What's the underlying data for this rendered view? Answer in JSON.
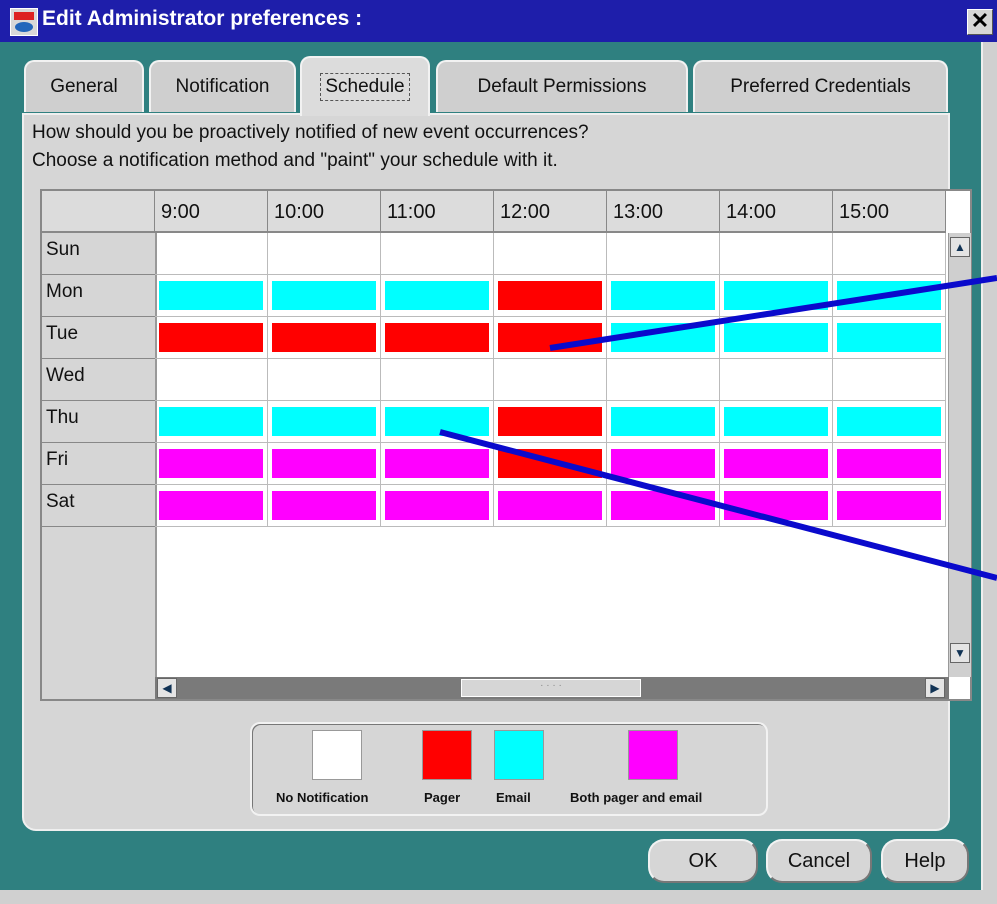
{
  "window": {
    "title": "Edit Administrator preferences :",
    "close_label": "✕"
  },
  "tabs": [
    {
      "label": "General",
      "active": false
    },
    {
      "label": "Notification",
      "active": false
    },
    {
      "label": "Schedule",
      "active": true
    },
    {
      "label": "Default Permissions",
      "active": false
    },
    {
      "label": "Preferred Credentials",
      "active": false
    }
  ],
  "instructions": {
    "line1": "How should you be proactively notified of new event occurrences?",
    "line2": "Choose a notification method and \"paint\" your schedule with it."
  },
  "schedule": {
    "hours": [
      "9:00",
      "10:00",
      "11:00",
      "12:00",
      "13:00",
      "14:00",
      "15:00"
    ],
    "days": [
      {
        "name": "Sun",
        "cells": [
          "none",
          "none",
          "none",
          "none",
          "none",
          "none",
          "none"
        ]
      },
      {
        "name": "Mon",
        "cells": [
          "email",
          "email",
          "email",
          "pager",
          "email",
          "email",
          "email"
        ]
      },
      {
        "name": "Tue",
        "cells": [
          "pager",
          "pager",
          "pager",
          "pager",
          "email",
          "email",
          "email"
        ]
      },
      {
        "name": "Wed",
        "cells": [
          "none",
          "none",
          "none",
          "none",
          "none",
          "none",
          "none"
        ]
      },
      {
        "name": "Thu",
        "cells": [
          "email",
          "email",
          "email",
          "pager",
          "email",
          "email",
          "email"
        ]
      },
      {
        "name": "Fri",
        "cells": [
          "both",
          "both",
          "both",
          "pager",
          "both",
          "both",
          "both"
        ]
      },
      {
        "name": "Sat",
        "cells": [
          "both",
          "both",
          "both",
          "both",
          "both",
          "both",
          "both"
        ]
      }
    ]
  },
  "legend": {
    "items": [
      {
        "key": "none",
        "label": "No Notification",
        "color": "#ffffff"
      },
      {
        "key": "pager",
        "label": "Pager",
        "color": "#ff0000"
      },
      {
        "key": "email",
        "label": "Email",
        "color": "#00ffff"
      },
      {
        "key": "both",
        "label": "Both pager and email",
        "color": "#ff00ff"
      }
    ]
  },
  "buttons": {
    "ok": "OK",
    "cancel": "Cancel",
    "help": "Help"
  },
  "colors": {
    "window_background": "#2f8080",
    "title_bar": "#1e1eaa",
    "annotation_lines": "#0a0acc"
  }
}
